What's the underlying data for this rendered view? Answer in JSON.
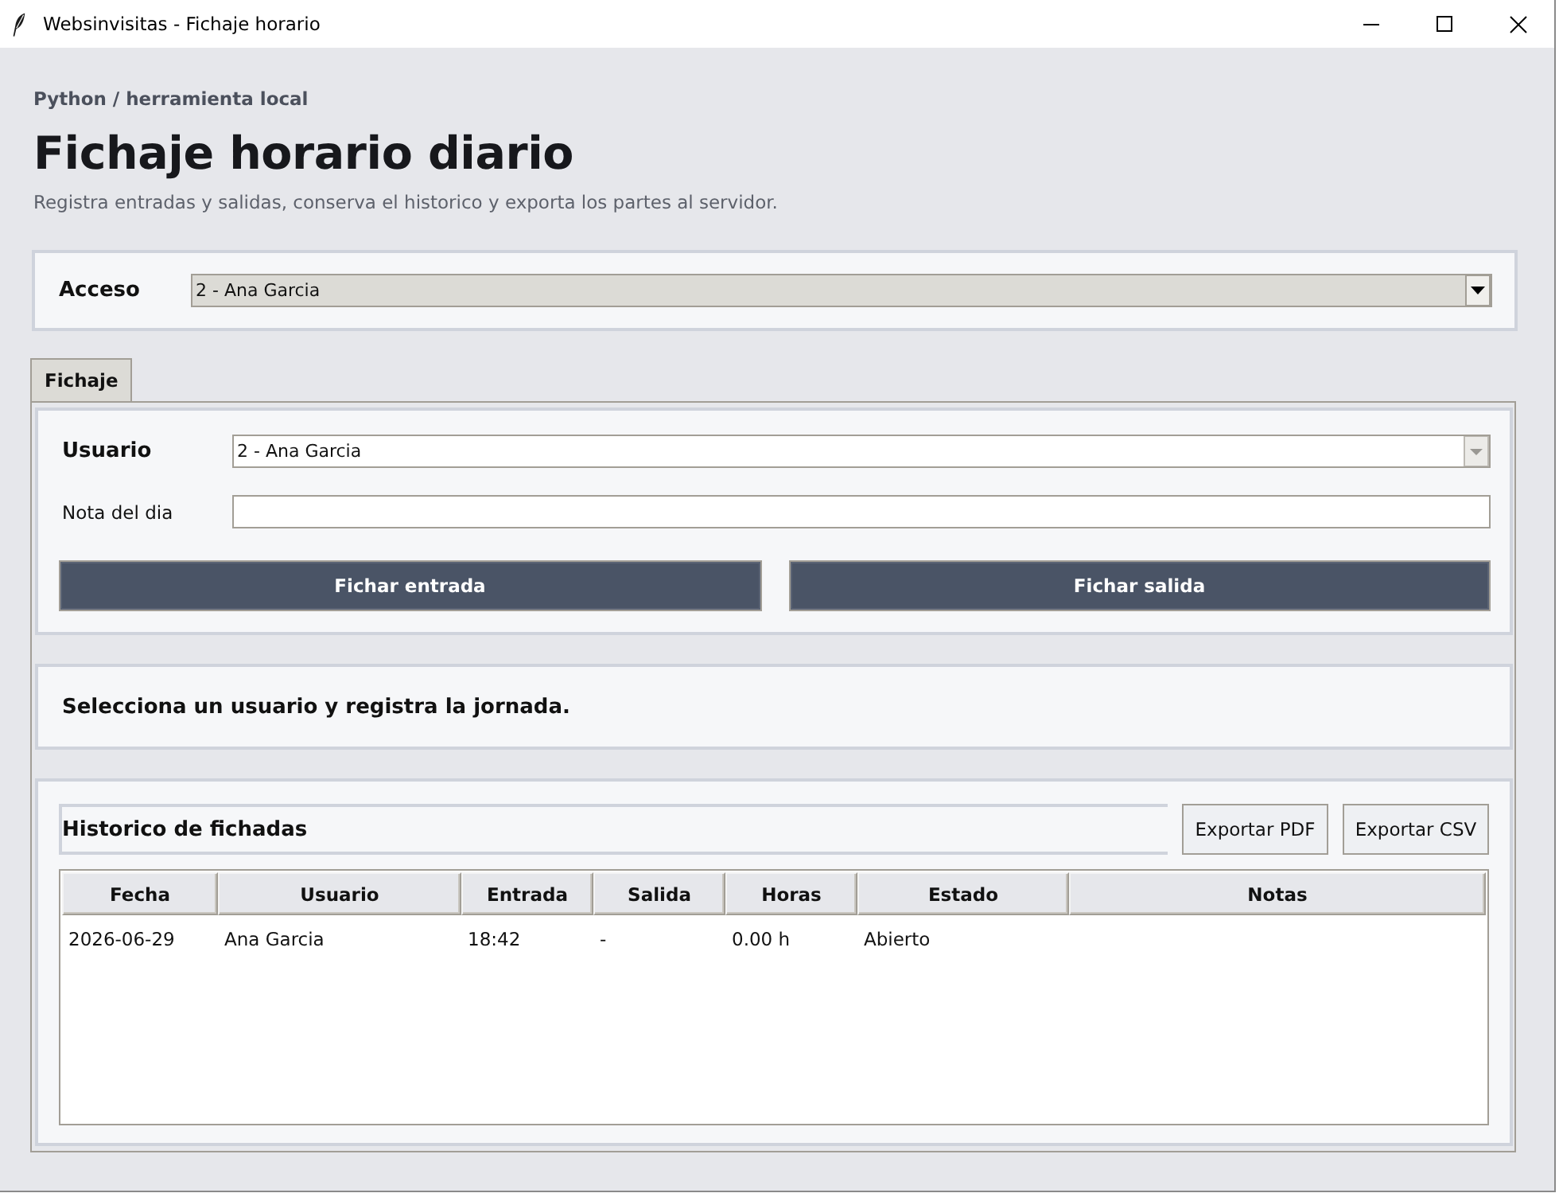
{
  "window": {
    "title": "Websinvisitas - Fichaje horario"
  },
  "header": {
    "eyebrow": "Python / herramienta local",
    "title": "Fichaje horario diario",
    "description": "Registra entradas y salidas, conserva el historico y exporta los partes al servidor."
  },
  "access": {
    "label": "Acceso",
    "value": "2 - Ana Garcia"
  },
  "tabs": [
    {
      "label": "Fichaje",
      "selected": true
    }
  ],
  "form": {
    "user_label": "Usuario",
    "user_value": "2 - Ana Garcia",
    "note_label": "Nota del dia",
    "buttons": [
      "Fichar entrada",
      "Fichar salida"
    ]
  },
  "status": {
    "message": "Selecciona un usuario y registra la jornada."
  },
  "history": {
    "title": "Historico de fichadas",
    "buttons": [
      "Exportar PDF",
      "Exportar CSV"
    ],
    "table": {
      "columns": [
        "Fecha",
        "Usuario",
        "Entrada",
        "Salida",
        "Horas",
        "Estado",
        "Notas"
      ],
      "rows": [
        {
          "cells": [
            "2026-06-29",
            "Ana Garcia",
            "18:42",
            "-",
            "0.00 h",
            "Abierto"
          ]
        }
      ]
    }
  }
}
